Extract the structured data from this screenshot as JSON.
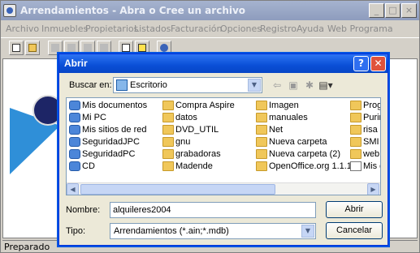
{
  "app": {
    "title": "Arrendamientos - Abra o Cree un archivo",
    "menu": [
      "Archivo",
      "Inmuebles",
      "Propietarios",
      "Listados",
      "Facturación",
      "Opciones",
      "Registro",
      "Ayuda",
      "Web Programa"
    ],
    "status": "Preparado",
    "window_buttons": [
      "_",
      "□",
      "×"
    ]
  },
  "dialog": {
    "title": "Abrir",
    "help": "?",
    "close": "✕",
    "look_in_label": "Buscar en:",
    "look_in_value": "Escritorio",
    "files_col1": [
      {
        "name": "Mis documentos",
        "kind": "special"
      },
      {
        "name": "Mi PC",
        "kind": "special"
      },
      {
        "name": "Mis sitios de red",
        "kind": "special"
      },
      {
        "name": "SeguridadJPC",
        "kind": "special"
      },
      {
        "name": "SeguridadPC",
        "kind": "special"
      },
      {
        "name": "CD",
        "kind": "special"
      }
    ],
    "files_col2": [
      {
        "name": "Compra Aspire",
        "kind": "folder"
      },
      {
        "name": "datos",
        "kind": "folder"
      },
      {
        "name": "DVD_UTIL",
        "kind": "folder"
      },
      {
        "name": "gnu",
        "kind": "folder"
      },
      {
        "name": "grabadoras",
        "kind": "folder"
      },
      {
        "name": "Madende",
        "kind": "folder"
      }
    ],
    "files_col3": [
      {
        "name": "Imagen",
        "kind": "folder"
      },
      {
        "name": "manuales",
        "kind": "folder"
      },
      {
        "name": "Net",
        "kind": "folder"
      },
      {
        "name": "Nueva carpeta",
        "kind": "folder"
      },
      {
        "name": "Nueva carpeta (2)",
        "kind": "folder"
      },
      {
        "name": "OpenOffice.org 1.1.1",
        "kind": "folder"
      }
    ],
    "files_col4": [
      {
        "name": "Progr",
        "kind": "folder"
      },
      {
        "name": "Purim",
        "kind": "folder"
      },
      {
        "name": "risa",
        "kind": "folder"
      },
      {
        "name": "SMI",
        "kind": "folder"
      },
      {
        "name": "web",
        "kind": "folder"
      },
      {
        "name": "Mis d",
        "kind": "file"
      }
    ],
    "filename_label": "Nombre:",
    "filename_value": "alquileres2004",
    "filetype_label": "Tipo:",
    "filetype_value": "Arrendamientos (*.ain;*.mdb)",
    "open_button": "Abrir",
    "cancel_button": "Cancelar"
  }
}
